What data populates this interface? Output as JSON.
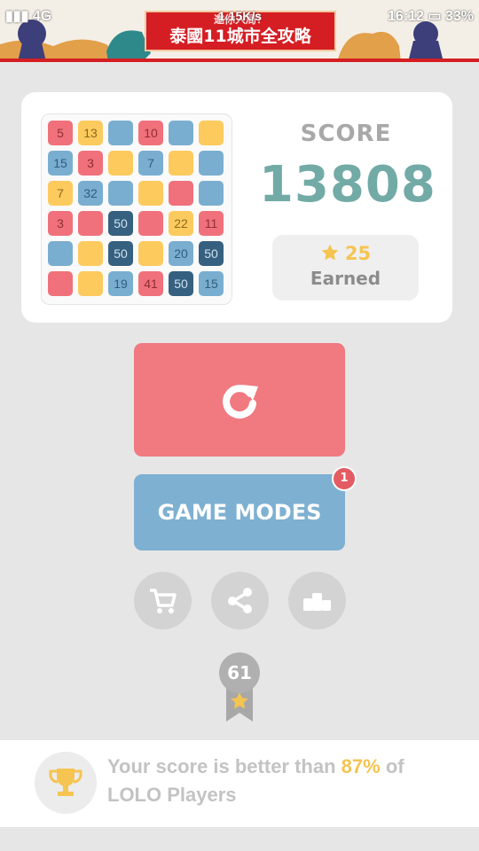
{
  "status_bar": {
    "signal": "4G",
    "speed": "1.15K/s",
    "time": "16:12",
    "battery": "33%"
  },
  "ad_banner": {
    "line1": "邀你入局！",
    "line2": "泰國11城市全攻略"
  },
  "board": {
    "colors": {
      "red": "#f0717b",
      "yellow": "#fdca5e",
      "blue": "#7aaed0",
      "navy": "#36607f"
    },
    "tiles": [
      {
        "color": "red",
        "text": "5"
      },
      {
        "color": "yellow",
        "text": "13"
      },
      {
        "color": "blue",
        "text": ""
      },
      {
        "color": "red",
        "text": "10"
      },
      {
        "color": "blue",
        "text": ""
      },
      {
        "color": "yellow",
        "text": ""
      },
      {
        "color": "blue",
        "text": "15"
      },
      {
        "color": "red",
        "text": "3"
      },
      {
        "color": "yellow",
        "text": ""
      },
      {
        "color": "blue",
        "text": "7"
      },
      {
        "color": "yellow",
        "text": ""
      },
      {
        "color": "blue",
        "text": ""
      },
      {
        "color": "yellow",
        "text": "7"
      },
      {
        "color": "blue",
        "text": "32"
      },
      {
        "color": "blue",
        "text": ""
      },
      {
        "color": "yellow",
        "text": ""
      },
      {
        "color": "red",
        "text": ""
      },
      {
        "color": "blue",
        "text": ""
      },
      {
        "color": "red",
        "text": "3"
      },
      {
        "color": "red",
        "text": ""
      },
      {
        "color": "navy",
        "text": "50"
      },
      {
        "color": "red",
        "text": ""
      },
      {
        "color": "yellow",
        "text": "22"
      },
      {
        "color": "red",
        "text": "11"
      },
      {
        "color": "blue",
        "text": ""
      },
      {
        "color": "yellow",
        "text": ""
      },
      {
        "color": "navy",
        "text": "50"
      },
      {
        "color": "yellow",
        "text": ""
      },
      {
        "color": "blue",
        "text": "20"
      },
      {
        "color": "navy",
        "text": "50"
      },
      {
        "color": "red",
        "text": ""
      },
      {
        "color": "yellow",
        "text": ""
      },
      {
        "color": "blue",
        "text": "19"
      },
      {
        "color": "red",
        "text": "41"
      },
      {
        "color": "navy",
        "text": "50"
      },
      {
        "color": "blue",
        "text": "15"
      }
    ]
  },
  "score": {
    "label": "SCORE",
    "value": "13808",
    "earned_count": "25",
    "earned_label": "Earned"
  },
  "buttons": {
    "game_modes_label": "GAME MODES",
    "game_modes_badge": "1"
  },
  "icons": {
    "restart": "restart-icon",
    "shop": "shopping-cart-icon",
    "share": "share-icon",
    "leaderboard": "podium-icon",
    "star": "star-icon",
    "trophy": "trophy-icon"
  },
  "level": {
    "number": "61"
  },
  "footer": {
    "text_before": "Your score is better than ",
    "percent": "87%",
    "text_after": " of LOLO Players"
  },
  "accent_colors": {
    "score": "#72aaa6",
    "restart": "#f07a80",
    "modes": "#7eb0d1",
    "gold": "#f5c451"
  }
}
